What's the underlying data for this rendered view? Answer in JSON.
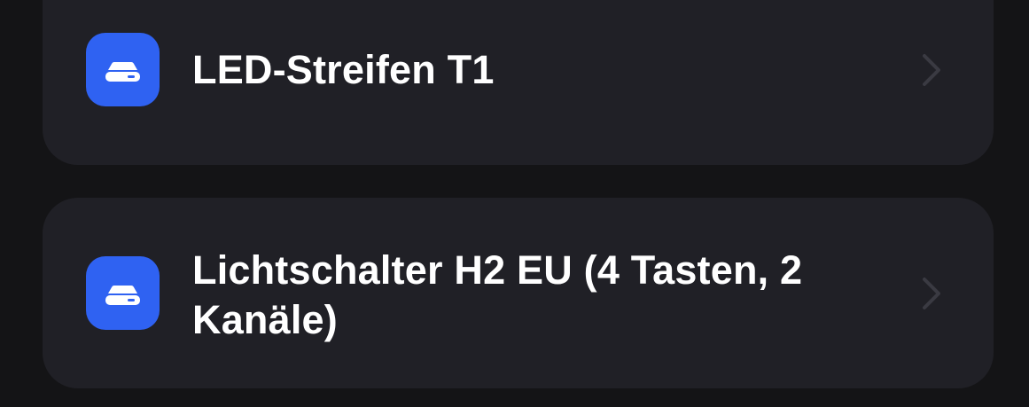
{
  "colors": {
    "background": "#141416",
    "card": "#202026",
    "icon_tile": "#2f62f2",
    "label": "#ffffff",
    "chevron": "#3a3a42"
  },
  "devices": [
    {
      "label": "LED-Streifen T1",
      "icon": "device-hub-icon",
      "accessory": "chevron-right-icon"
    },
    {
      "label": "Lichtschalter H2 EU (4 Tasten, 2 Kanäle)",
      "icon": "device-hub-icon",
      "accessory": "chevron-right-icon"
    }
  ]
}
